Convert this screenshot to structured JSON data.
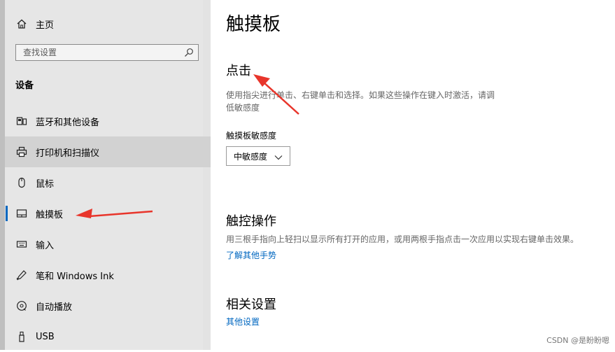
{
  "sidebar": {
    "home_label": "主页",
    "search_placeholder": "查找设置",
    "section_title": "设备",
    "items": [
      {
        "label": "蓝牙和其他设备",
        "icon": "bluetooth-devices-icon"
      },
      {
        "label": "打印机和扫描仪",
        "icon": "printer-icon"
      },
      {
        "label": "鼠标",
        "icon": "mouse-icon"
      },
      {
        "label": "触摸板",
        "icon": "touchpad-icon",
        "selected": true
      },
      {
        "label": "输入",
        "icon": "keyboard-icon"
      },
      {
        "label": "笔和 Windows Ink",
        "icon": "pen-icon"
      },
      {
        "label": "自动播放",
        "icon": "autoplay-icon"
      },
      {
        "label": "USB",
        "icon": "usb-icon"
      }
    ]
  },
  "main": {
    "page_title": "触摸板",
    "taps": {
      "heading": "点击",
      "description_line1": "使用指尖进行单击、右键单击和选择。如果这些操作在键入时激活，请调",
      "description_line2": "低敏感度",
      "sensitivity_label": "触摸板敏感度",
      "sensitivity_value": "中敏感度"
    },
    "touch_gestures": {
      "heading": "触控操作",
      "description": "用三根手指向上轻扫以显示所有打开的应用，或用两根手指点击一次应用以实现右键单击效果。",
      "link": "了解其他手势"
    },
    "related": {
      "heading": "相关设置",
      "link": "其他设置"
    }
  },
  "watermark": "CSDN @是盼盼嗯",
  "colors": {
    "accent": "#0067c0",
    "sidebar_bg": "#e6e6e6",
    "annotation_arrow": "#e8352b"
  }
}
